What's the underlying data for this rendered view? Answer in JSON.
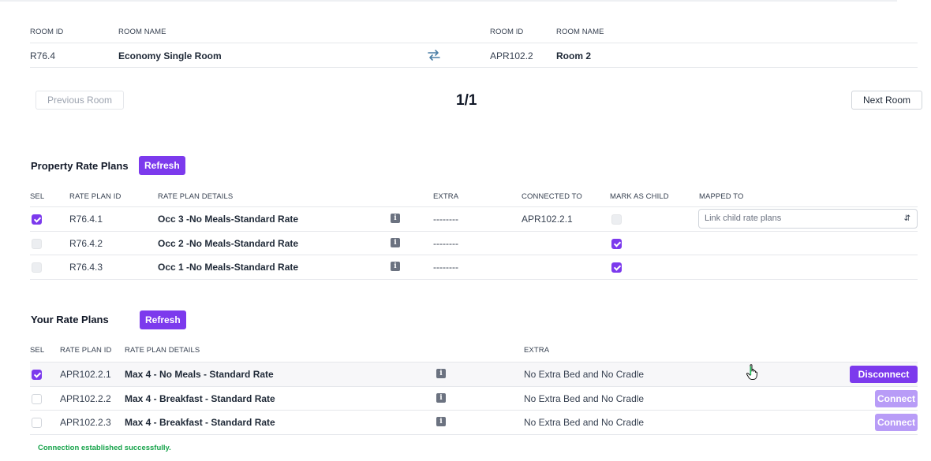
{
  "room_mapping": {
    "headers": {
      "left_id": "ROOM ID",
      "left_name": "ROOM NAME",
      "right_id": "ROOM ID",
      "right_name": "ROOM NAME"
    },
    "row": {
      "left_id": "R76.4",
      "left_name": "Economy Single Room",
      "right_id": "APR102.2",
      "right_name": "Room 2"
    },
    "swap_icon": "swap-arrows-icon",
    "prev_label": "Previous Room",
    "next_label": "Next Room",
    "pager": "1/1"
  },
  "property_rate_plans": {
    "title": "Property Rate Plans",
    "refresh_label": "Refresh",
    "headers": {
      "sel": "SEL",
      "id": "RATE PLAN ID",
      "details": "RATE PLAN DETAILS",
      "extra": "EXTRA",
      "connected": "CONNECTED TO",
      "mark_child": "MARK AS CHILD",
      "mapped": "MAPPED TO"
    },
    "rows": [
      {
        "selected": true,
        "id": "R76.4.1",
        "details": "Occ 3  -No Meals-Standard Rate",
        "extra": "--------",
        "connected_to": "APR102.2.1",
        "mark_child": false,
        "mark_child_disabled": true,
        "mapped_to_placeholder": "Link child rate plans"
      },
      {
        "selected": false,
        "id": "R76.4.2",
        "details": "Occ 2  -No Meals-Standard Rate",
        "extra": "--------",
        "connected_to": "",
        "mark_child": true,
        "mark_child_disabled": false,
        "mapped_to_placeholder": ""
      },
      {
        "selected": false,
        "id": "R76.4.3",
        "details": "Occ 1 -No Meals-Standard Rate",
        "extra": "--------",
        "connected_to": "",
        "mark_child": true,
        "mark_child_disabled": false,
        "mapped_to_placeholder": ""
      }
    ],
    "info_icon": "info-icon"
  },
  "your_rate_plans": {
    "title": "Your Rate Plans",
    "refresh_label": "Refresh",
    "headers": {
      "sel": "SEL",
      "id": "RATE PLAN ID",
      "details": "RATE PLAN DETAILS",
      "extra": "EXTRA"
    },
    "rows": [
      {
        "selected": true,
        "id": "APR102.2.1",
        "details": "Max 4 - No Meals - Standard Rate",
        "extra": "No Extra Bed and No Cradle",
        "action": "Disconnect"
      },
      {
        "selected": false,
        "id": "APR102.2.2",
        "details": "Max 4 - Breakfast - Standard Rate",
        "extra": "No Extra Bed and No Cradle",
        "action": "Connect"
      },
      {
        "selected": false,
        "id": "APR102.2.3",
        "details": "Max 4 - Breakfast - Standard Rate",
        "extra": "No Extra Bed and No Cradle",
        "action": "Connect"
      }
    ]
  },
  "status_message": "Connection established successfully.",
  "colors": {
    "accent": "#7c3aed",
    "accent_light": "#b89cf7",
    "success": "#16a34a"
  }
}
